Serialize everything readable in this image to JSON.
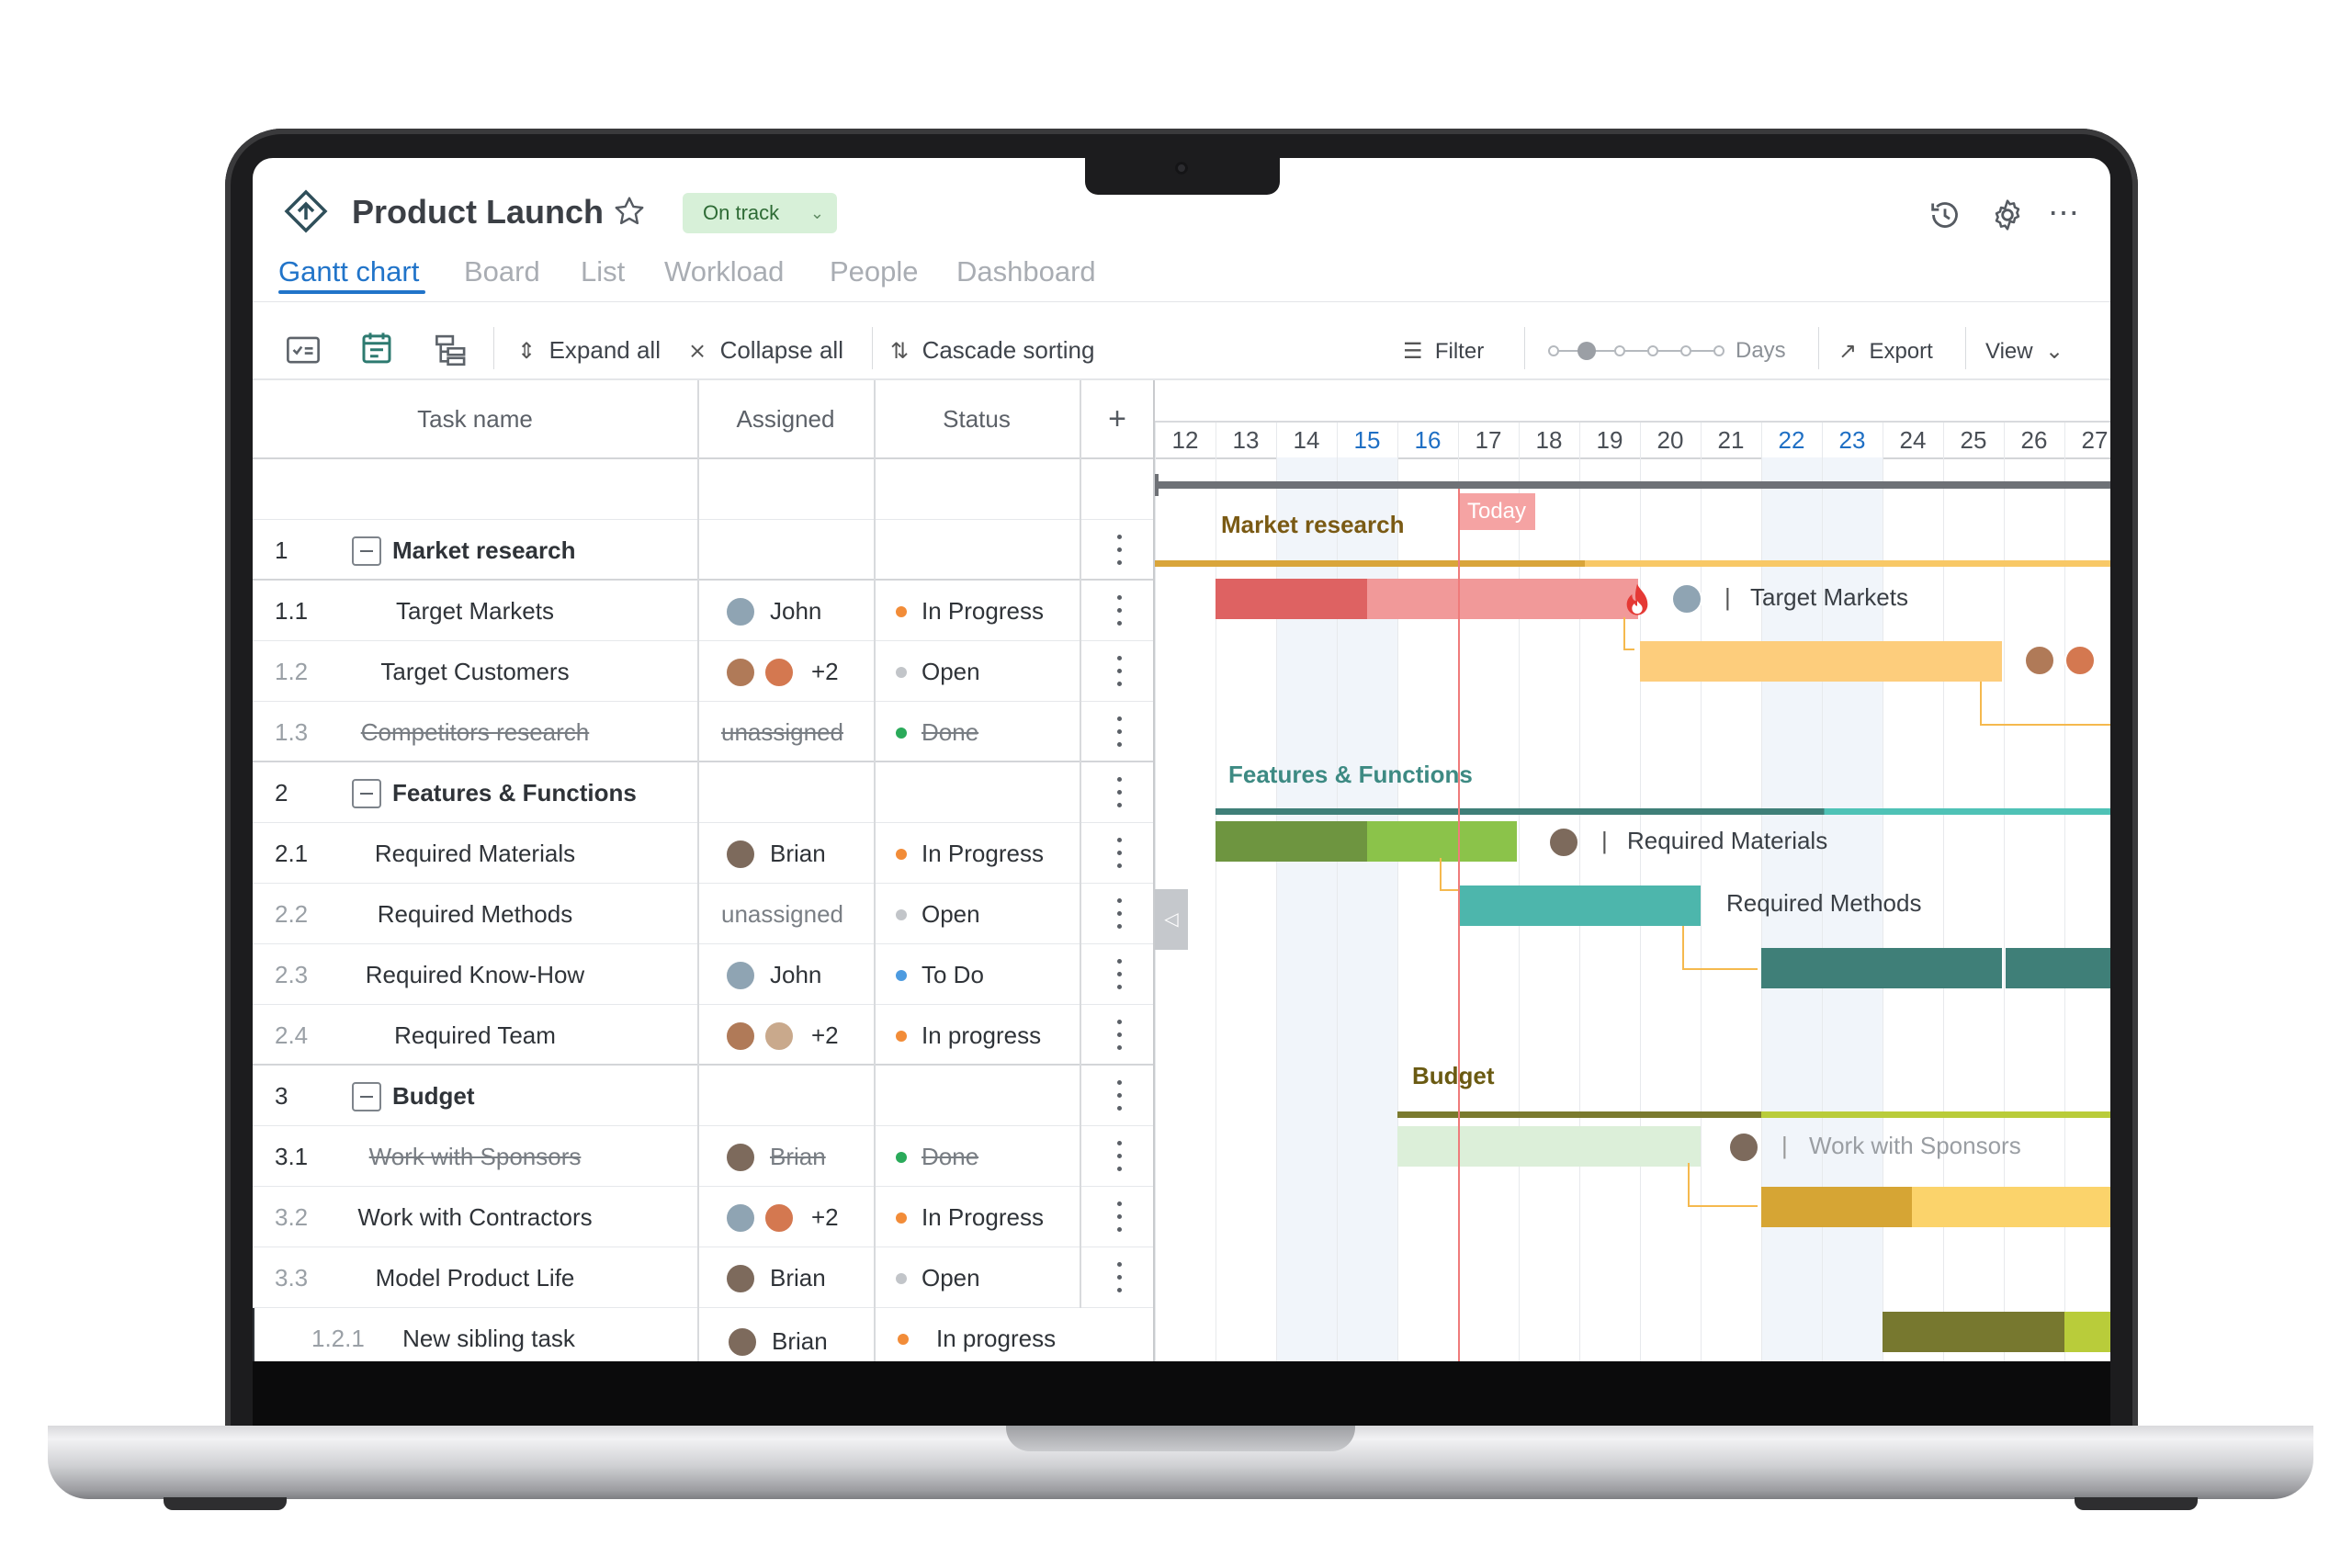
{
  "app": {
    "title": "Product Launch",
    "status": "On track",
    "tabs": [
      "Gantt chart",
      "Board",
      "List",
      "Workload",
      "People",
      "Dashboard"
    ]
  },
  "toolbar": {
    "expand_all": "Expand all",
    "collapse_all": "Collapse all",
    "cascade_sorting": "Cascade sorting",
    "filter": "Filter",
    "zoom_label": "Days",
    "export": "Export",
    "view": "View"
  },
  "grid": {
    "columns": [
      "Task name",
      "Assigned",
      "Status"
    ],
    "rows": [
      {
        "num": "1",
        "name": "Market research",
        "group": true
      },
      {
        "num": "1.1",
        "name": "Target Markets",
        "assigned": "John",
        "status": "In Progress",
        "status_color": "#f28c38"
      },
      {
        "num": "1.2",
        "name": "Target Customers",
        "assigned": "+2",
        "status": "Open",
        "status_color": "#c2c5c9"
      },
      {
        "num": "1.3",
        "name": "Competitors research",
        "assigned": "unassigned",
        "status": "Done",
        "status_color": "#2aaa5a",
        "done": true
      },
      {
        "num": "2",
        "name": "Features & Functions",
        "group": true
      },
      {
        "num": "2.1",
        "name": "Required Materials",
        "assigned": "Brian",
        "status": "In Progress",
        "status_color": "#f28c38"
      },
      {
        "num": "2.2",
        "name": "Required Methods",
        "assigned": "unassigned",
        "status": "Open",
        "status_color": "#c2c5c9"
      },
      {
        "num": "2.3",
        "name": "Required Know-How",
        "assigned": "John",
        "status": "To Do",
        "status_color": "#4d9be0"
      },
      {
        "num": "2.4",
        "name": "Required Team",
        "assigned": "+2",
        "status": "In progress",
        "status_color": "#f28c38"
      },
      {
        "num": "3",
        "name": "Budget",
        "group": true
      },
      {
        "num": "3.1",
        "name": "Work with Sponsors",
        "assigned": "Brian",
        "status": "Done",
        "status_color": "#2aaa5a",
        "done": true
      },
      {
        "num": "3.2",
        "name": "Work with Contractors",
        "assigned": "+2",
        "status": "In Progress",
        "status_color": "#f28c38"
      },
      {
        "num": "3.3",
        "name": "Model Product Life",
        "assigned": "Brian",
        "status": "Open",
        "status_color": "#c2c5c9"
      },
      {
        "num": "1.2.1",
        "name": "New sibling task",
        "assigned": "Brian",
        "status": "In progress",
        "status_color": "#f28c38"
      }
    ]
  },
  "timeline": {
    "days": [
      "12",
      "13",
      "14",
      "15",
      "16",
      "17",
      "18",
      "19",
      "20",
      "21",
      "22",
      "23",
      "24",
      "25",
      "26",
      "27"
    ],
    "highlight_days": [
      "15",
      "16",
      "22",
      "23"
    ],
    "today_label": "Today",
    "group_labels": {
      "market": "Market research",
      "features": "Features & Functions",
      "budget": "Budget"
    },
    "task_labels": {
      "target_markets": "Target Markets",
      "required_materials": "Required Materials",
      "required_methods": "Required Methods",
      "work_with_sponsors": "Work with Sponsors"
    }
  }
}
